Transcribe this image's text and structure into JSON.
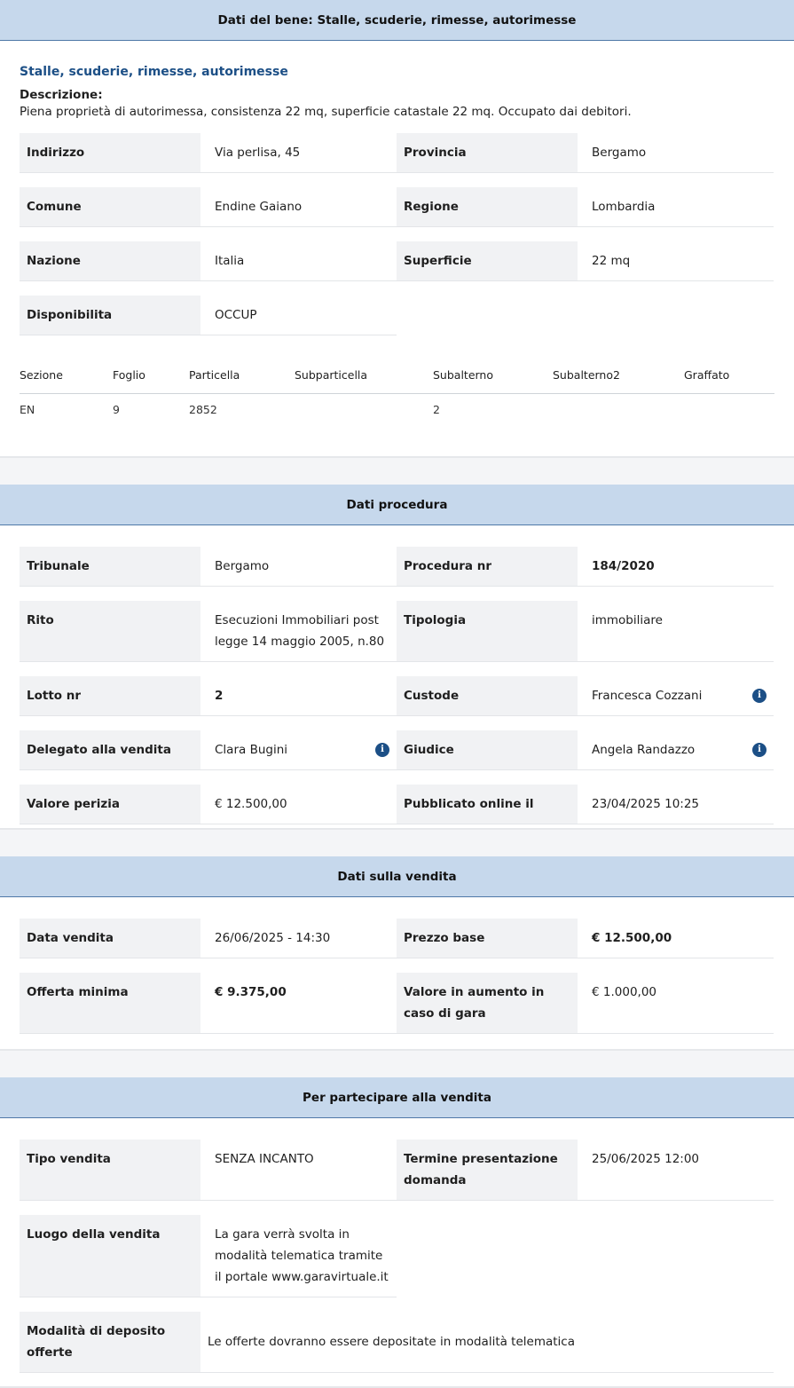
{
  "bene": {
    "header": "Dati del bene: Stalle, scuderie, rimesse, autorimesse",
    "subtitle": "Stalle, scuderie, rimesse, autorimesse",
    "desc_label": "Descrizione:",
    "desc_text": "Piena proprietà di autorimessa, consistenza 22 mq, superficie catastale 22 mq. Occupato dai debitori.",
    "fields": {
      "indirizzo": {
        "label": "Indirizzo",
        "value": "Via perlisa, 45"
      },
      "provincia": {
        "label": "Provincia",
        "value": "Bergamo"
      },
      "comune": {
        "label": "Comune",
        "value": "Endine Gaiano"
      },
      "regione": {
        "label": "Regione",
        "value": "Lombardia"
      },
      "nazione": {
        "label": "Nazione",
        "value": "Italia"
      },
      "superficie": {
        "label": "Superficie",
        "value": "22 mq"
      },
      "disponibilita": {
        "label": "Disponibilita",
        "value": "OCCUP"
      }
    },
    "catasto": {
      "headers": [
        "Sezione",
        "Foglio",
        "Particella",
        "Subparticella",
        "Subalterno",
        "Subalterno2",
        "Graffato"
      ],
      "row": [
        "EN",
        "9",
        "2852",
        "",
        "2",
        "",
        ""
      ]
    }
  },
  "procedura": {
    "header": "Dati procedura",
    "fields": {
      "tribunale": {
        "label": "Tribunale",
        "value": "Bergamo"
      },
      "procedura_nr": {
        "label": "Procedura nr",
        "value": "184/2020"
      },
      "rito": {
        "label": "Rito",
        "value": "Esecuzioni Immobiliari post legge 14 maggio 2005, n.80"
      },
      "tipologia": {
        "label": "Tipologia",
        "value": "immobiliare"
      },
      "lotto": {
        "label": "Lotto nr",
        "value": "2"
      },
      "custode": {
        "label": "Custode",
        "value": "Francesca Cozzani"
      },
      "delegato": {
        "label": "Delegato alla vendita",
        "value": "Clara Bugini"
      },
      "giudice": {
        "label": "Giudice",
        "value": "Angela Randazzo"
      },
      "valore_perizia": {
        "label": "Valore perizia",
        "value": "€ 12.500,00"
      },
      "pubblicato": {
        "label": "Pubblicato online il",
        "value": "23/04/2025 10:25"
      }
    }
  },
  "vendita": {
    "header": "Dati sulla vendita",
    "fields": {
      "data_vendita": {
        "label": "Data vendita",
        "value": "26/06/2025 - 14:30"
      },
      "prezzo_base": {
        "label": "Prezzo base",
        "value": "€ 12.500,00"
      },
      "offerta_minima": {
        "label": "Offerta minima",
        "value": "€ 9.375,00"
      },
      "aumento": {
        "label": "Valore in aumento in caso di gara",
        "value": "€ 1.000,00"
      }
    }
  },
  "partecipare": {
    "header": "Per partecipare alla vendita",
    "fields": {
      "tipo_vendita": {
        "label": "Tipo vendita",
        "value": "SENZA INCANTO"
      },
      "termine": {
        "label": "Termine presentazione domanda",
        "value": "25/06/2025 12:00"
      },
      "luogo": {
        "label": "Luogo della vendita",
        "value": "La gara verrà svolta in modalità telematica tramite il portale www.garavirtuale.it"
      },
      "modalita": {
        "label": "Modalità di deposito offerte",
        "value": "Le offerte dovranno essere depositate in modalità telematica"
      }
    }
  },
  "icons": {
    "info": "info-icon"
  },
  "colors": {
    "header_bg": "#c6d8ec",
    "accent": "#1c4f86",
    "label_bg": "#f1f2f4"
  }
}
